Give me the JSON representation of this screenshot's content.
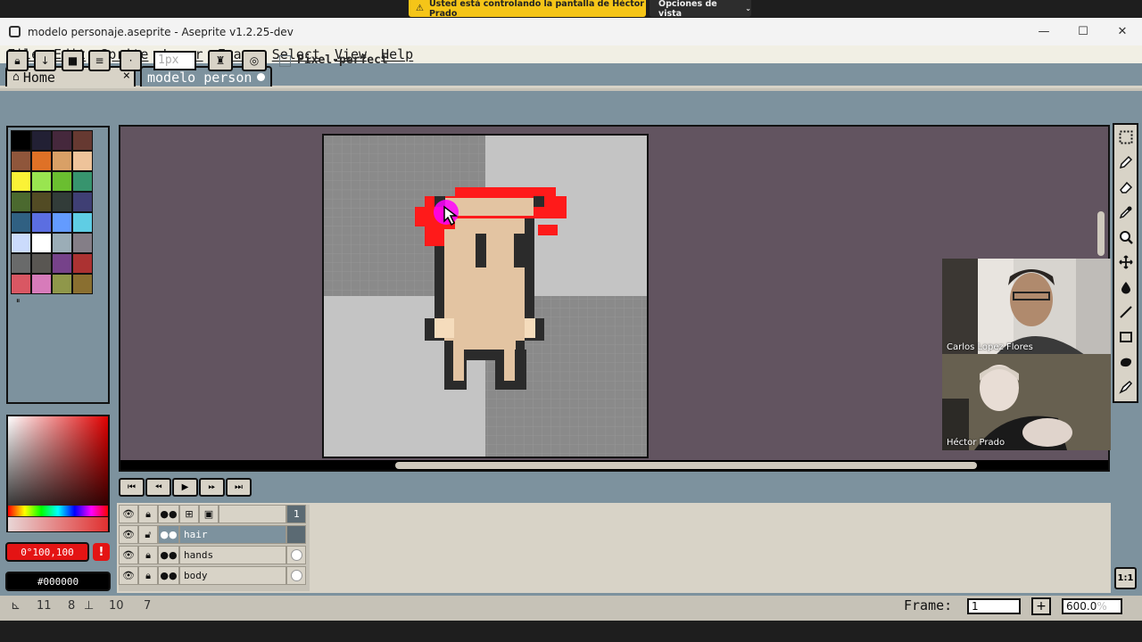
{
  "banner": {
    "message": "Usted está controlando la pantalla de Héctor Prado",
    "options_label": "Opciones de vista"
  },
  "window": {
    "title": "modelo personaje.aseprite - Aseprite v1.2.25-dev",
    "minimize_glyph": "—",
    "maximize_glyph": "☐",
    "close_glyph": "✕"
  },
  "menu": {
    "items": [
      "File",
      "Edit",
      "Sprite",
      "Layer",
      "Frame",
      "Select",
      "View",
      "Help"
    ]
  },
  "tabs": {
    "home_label": "Home",
    "home_close": "×",
    "doc_label": "modelo person"
  },
  "toolbar": {
    "brush_size_placeholder": "1px",
    "pixel_perfect_label": "Pixel-perfect"
  },
  "palette": {
    "colors": [
      "#000000",
      "#222034",
      "#45283c",
      "#663931",
      "#8f563b",
      "#df7126",
      "#d9a066",
      "#eec39a",
      "#fbf236",
      "#99e550",
      "#6abe30",
      "#37946e",
      "#4b692f",
      "#524b24",
      "#323c39",
      "#3f3f74",
      "#306082",
      "#5b6ee1",
      "#639bff",
      "#5fcde4",
      "#cbdbfc",
      "#ffffff",
      "#9badb7",
      "#847e87",
      "#696a6a",
      "#595652",
      "#76428a",
      "#ac3232",
      "#d95763",
      "#d77bba",
      "#8f974a",
      "#8a6f30"
    ]
  },
  "colors": {
    "foreground_label": "0°100,100",
    "background_label": "#000000",
    "warning_badge": "!"
  },
  "editor": {
    "checker_dark": "#8a8a8a",
    "checker_light": "#c4c4c4",
    "editor_bg": "#625460",
    "sprite": {
      "skin": "#e3c4a2",
      "outline": "#2b2b2b",
      "hair_red": "#ff1a1a",
      "hand_light": "#f5dcbc",
      "cursor_magenta": "#ff00ff"
    }
  },
  "video": {
    "participant1": "Carlos Lopez Flores",
    "participant2": "Héctor Prado"
  },
  "timeline": {
    "frame_header": "1",
    "layers": [
      {
        "name": "hair",
        "selected": true
      },
      {
        "name": "hands",
        "selected": false
      },
      {
        "name": "body",
        "selected": false
      }
    ]
  },
  "status": {
    "x_value": "11",
    "y_value": "8",
    "w_value": "10",
    "h_value": "7",
    "frame_label": "Frame:",
    "frame_value": "1",
    "frame_add": "+",
    "zoom_value": "600.0",
    "zoom_unit": "%"
  }
}
